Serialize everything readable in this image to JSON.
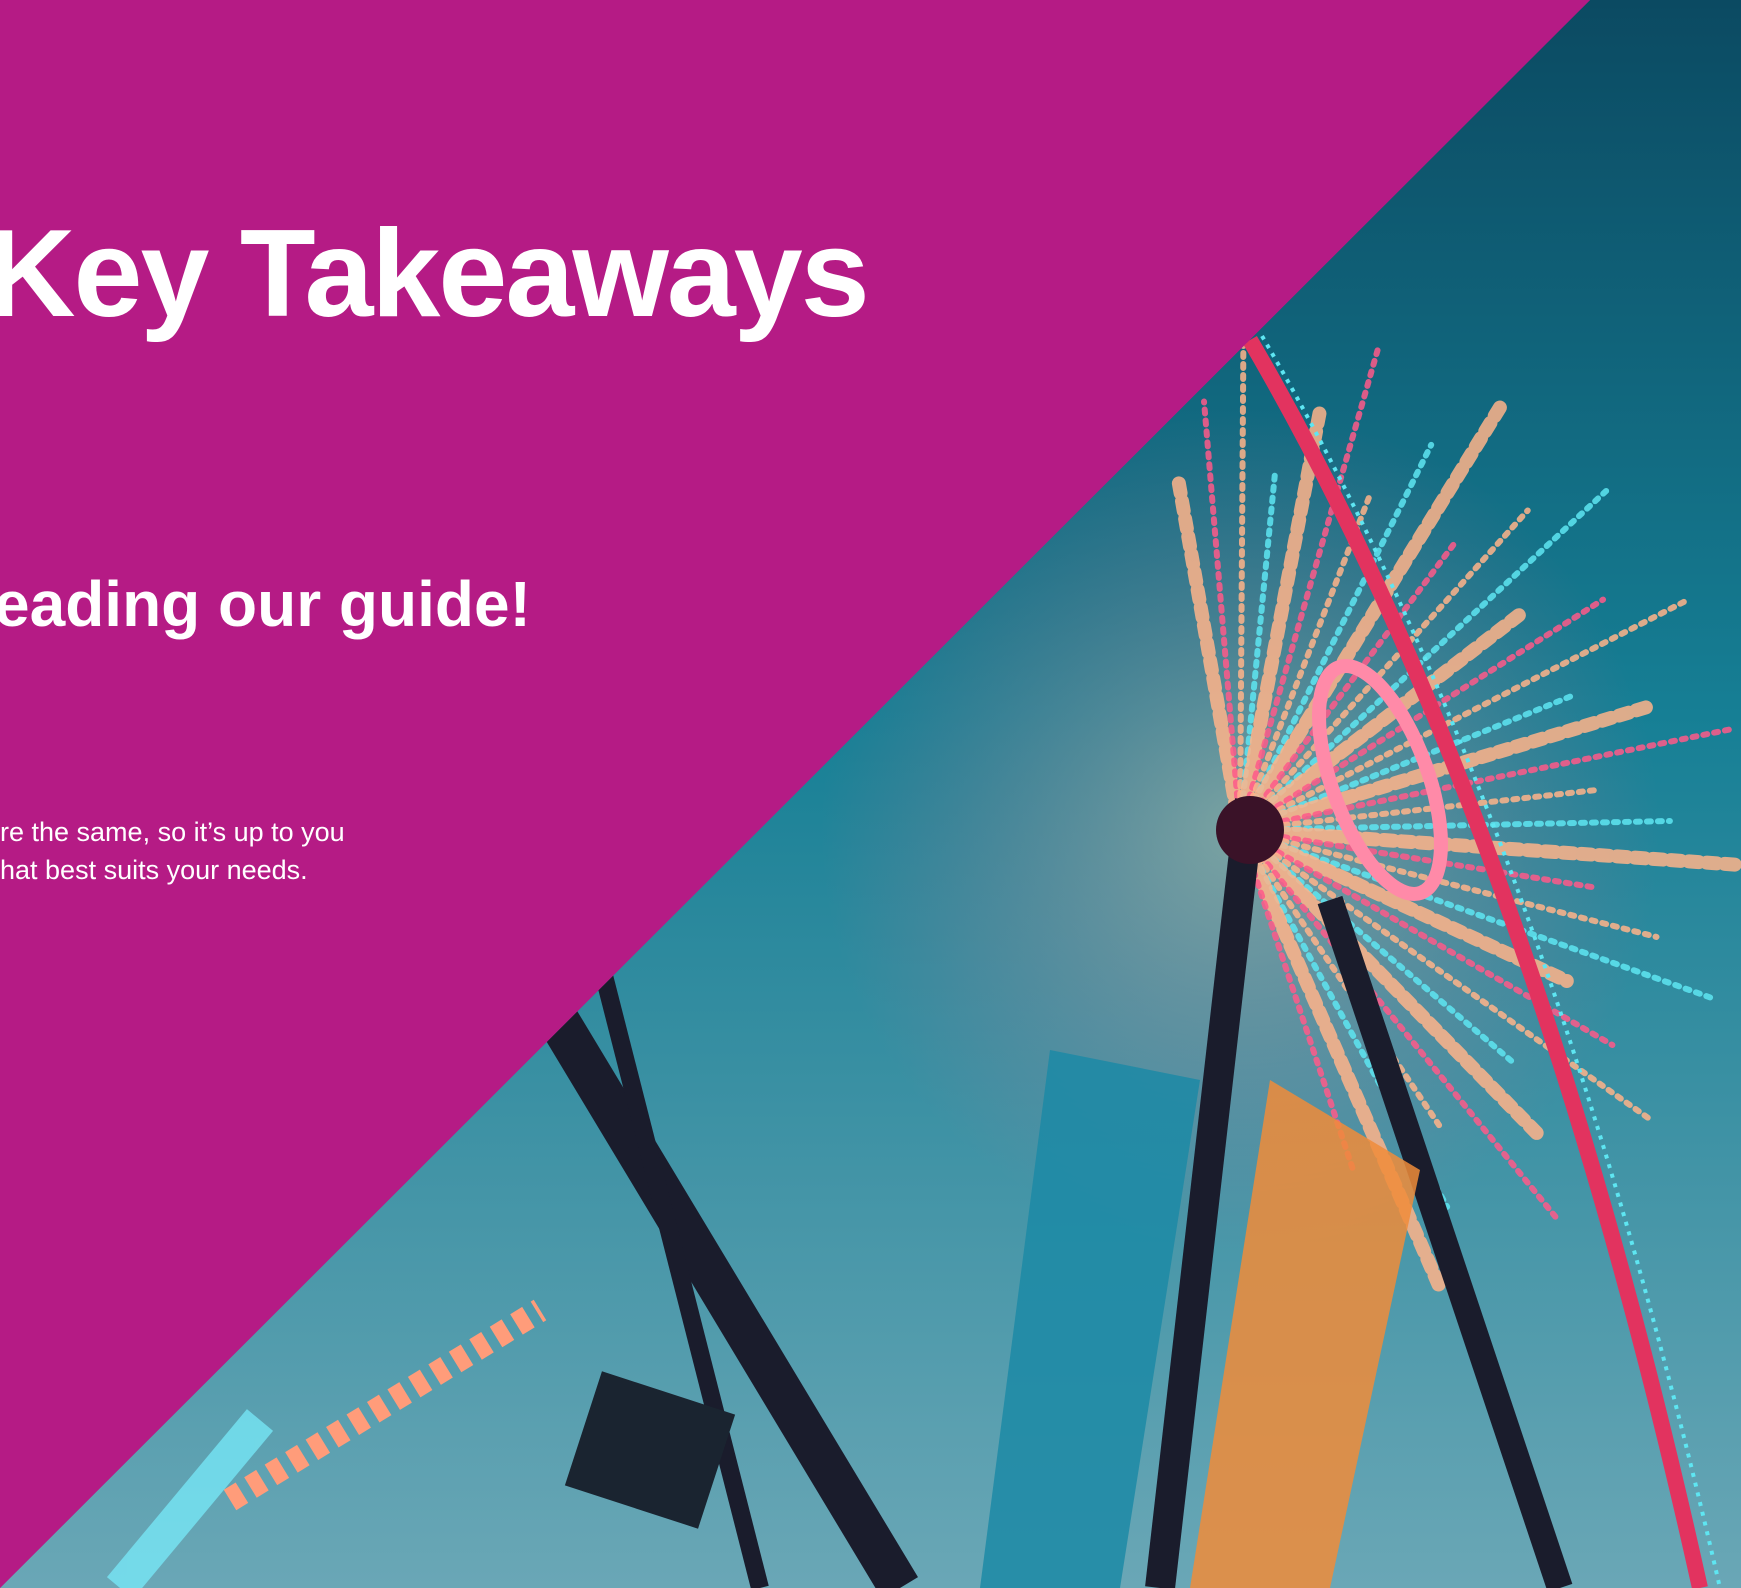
{
  "slide": {
    "title": "Key Takeaways",
    "subtitle": "eading our guide!",
    "body_lines": [
      "re the same, so it’s up to you",
      "hat best suits your needs."
    ]
  },
  "colors": {
    "background": "#b51b85",
    "text": "#ffffff",
    "sky_top": "#0b4a62",
    "sky_mid": "#167f95",
    "sky_bottom": "#6aa7b6",
    "light_orange": "#ffb48a",
    "light_pink": "#ff5a8a",
    "frame_dark": "#1a1c2c",
    "light_cyan": "#5ee6f2"
  },
  "photo": {
    "subject": "ferris wheel with lights against a blue sky"
  }
}
